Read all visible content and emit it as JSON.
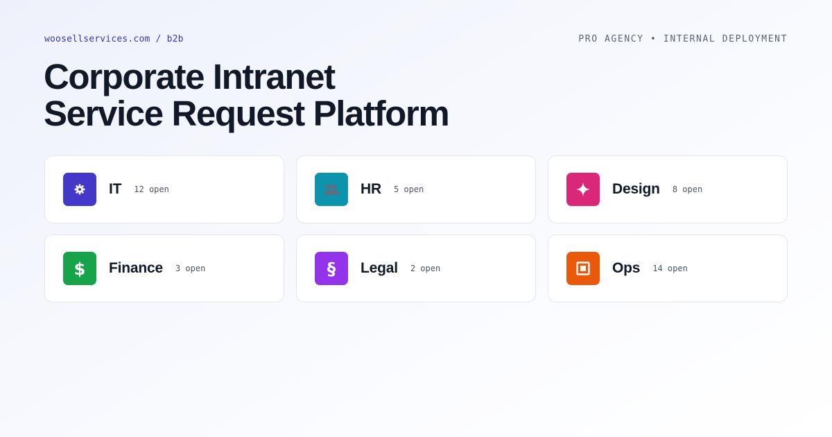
{
  "header": {
    "breadcrumb": "woosellservices.com / b2b",
    "context": "PRO AGENCY • INTERNAL DEPLOYMENT"
  },
  "title": {
    "line1": "Corporate Intranet",
    "line2": "Service Request Platform"
  },
  "departments": [
    {
      "name": "IT",
      "open": "12 open",
      "icon": "gear-icon",
      "color": "#4338ca"
    },
    {
      "name": "HR",
      "open": "5 open",
      "icon": "people-icon",
      "color": "#0e93ae"
    },
    {
      "name": "Design",
      "open": "8 open",
      "icon": "sparkle-icon",
      "color": "#db2777"
    },
    {
      "name": "Finance",
      "open": "3 open",
      "icon": "dollar-icon",
      "color": "#16a34a"
    },
    {
      "name": "Legal",
      "open": "2 open",
      "icon": "section-icon",
      "color": "#9333ea"
    },
    {
      "name": "Ops",
      "open": "14 open",
      "icon": "box-icon",
      "color": "#ea580c"
    }
  ]
}
